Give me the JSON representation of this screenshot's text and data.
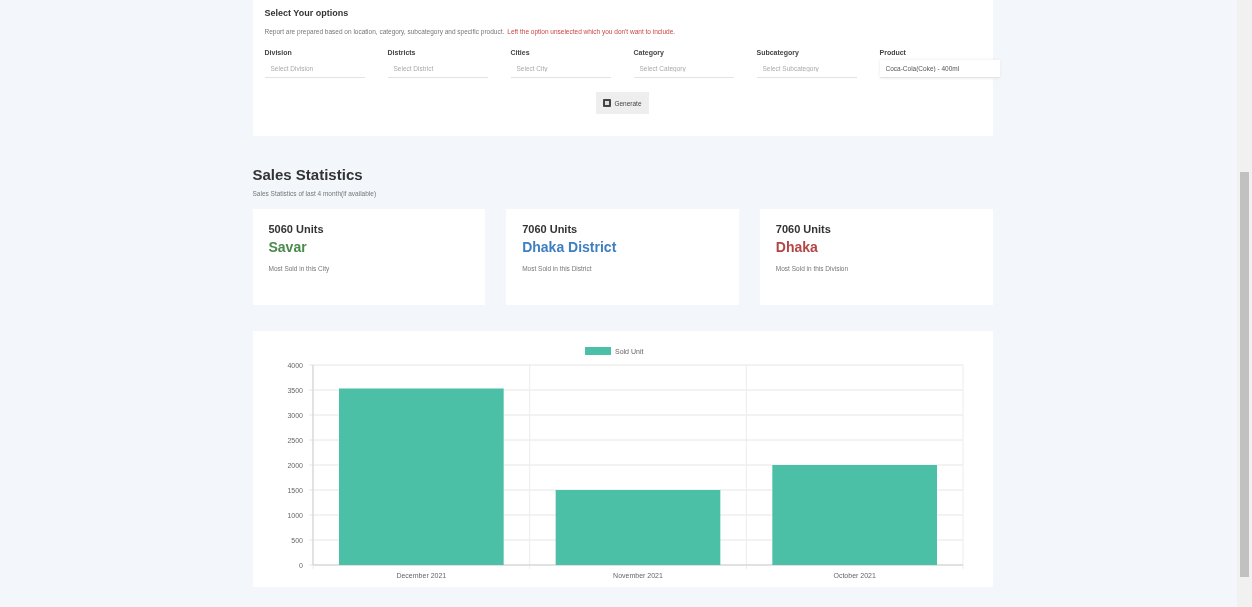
{
  "options": {
    "title": "Select Your options",
    "description": "Report are prepared based on location, category, subcategory and specific product.",
    "warning": "Left the option unselected which you don't want to include.",
    "fields": [
      {
        "label": "Division",
        "placeholder": "Select Division"
      },
      {
        "label": "Districts",
        "placeholder": "Select District"
      },
      {
        "label": "Cities",
        "placeholder": "Select City"
      },
      {
        "label": "Category",
        "placeholder": "Select Category"
      },
      {
        "label": "Subcategory",
        "placeholder": "Select Subcategory"
      },
      {
        "label": "Product",
        "value": "Coca-Cola(Coke) - 400ml"
      }
    ],
    "button": "Generate"
  },
  "stats": {
    "title": "Sales Statistics",
    "subtitle": "Sales Statistics of last 4 month(if available)",
    "cards": [
      {
        "units": "5060 Units",
        "place": "Savar",
        "color": "#4a8a4a",
        "caption": "Most Sold in this City"
      },
      {
        "units": "7060 Units",
        "place": "Dhaka District",
        "color": "#3d7fc0",
        "caption": "Most Sold in this District"
      },
      {
        "units": "7060 Units",
        "place": "Dhaka",
        "color": "#b54545",
        "caption": "Most Sold in this Division"
      }
    ]
  },
  "chart": {
    "chart_data": {
      "type": "bar",
      "categories": [
        "December 2021",
        "November 2021",
        "October 2021"
      ],
      "series": [
        {
          "name": "Sold Unit",
          "color": "#4bc0a6",
          "values": [
            3530,
            1500,
            2000
          ]
        }
      ],
      "ylim": [
        0,
        4000
      ],
      "grid": true,
      "yticks": [
        0,
        500,
        1000,
        1500,
        2000,
        2500,
        3000,
        3500,
        4000
      ]
    }
  }
}
